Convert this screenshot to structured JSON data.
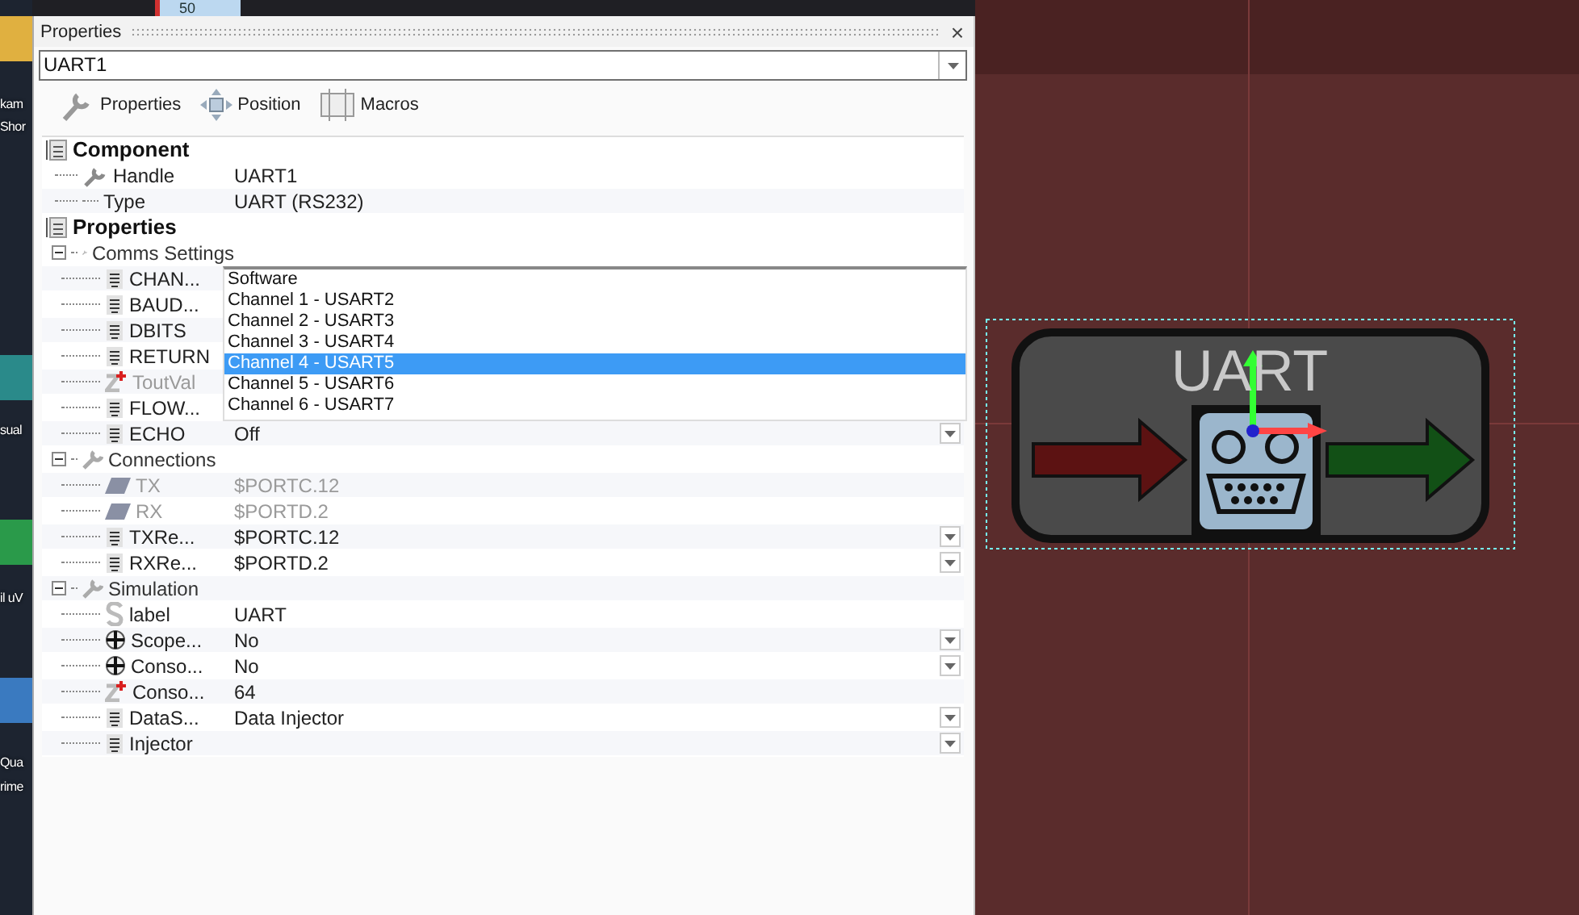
{
  "desktop_icons": [
    {
      "label": "kam",
      "top": "Shor"
    },
    {
      "label": "sual"
    },
    {
      "label": "il uV"
    },
    {
      "label": "Qua",
      "top": "rime"
    }
  ],
  "top_strip": {
    "text": "50"
  },
  "panel": {
    "title": "Properties",
    "close": "×",
    "selector": {
      "value": "UART1"
    },
    "tabs": [
      {
        "label": "Properties"
      },
      {
        "label": "Position"
      },
      {
        "label": "Macros"
      }
    ]
  },
  "grid": [
    {
      "title": "Component",
      "children": [
        {
          "kind": "wrench",
          "name": "Handle",
          "value": "UART1",
          "disabled": false,
          "dropdown": false
        },
        {
          "kind": "plain",
          "name": "Type",
          "value": "UART (RS232)",
          "disabled": false,
          "dropdown": false
        }
      ]
    },
    {
      "title": "Properties",
      "children": [
        {
          "kind": "group",
          "title": "Comms Settings",
          "expanded": true,
          "children": [
            {
              "kind": "list",
              "name": "CHAN...",
              "disabled": false,
              "dropdown": false
            },
            {
              "kind": "list",
              "name": "BAUD...",
              "disabled": false,
              "dropdown": false
            },
            {
              "kind": "list",
              "name": "DBITS",
              "disabled": false,
              "dropdown": false
            },
            {
              "kind": "list",
              "name": "RETURN",
              "disabled": false,
              "dropdown": false
            },
            {
              "kind": "number",
              "name": "ToutVal",
              "disabled": true,
              "dropdown": false
            },
            {
              "kind": "list",
              "name": "FLOW...",
              "disabled": false,
              "dropdown": false
            },
            {
              "kind": "list",
              "name": "ECHO",
              "value": "Off",
              "disabled": false,
              "dropdown": true
            }
          ]
        },
        {
          "kind": "group",
          "title": "Connections",
          "expanded": true,
          "children": [
            {
              "kind": "port",
              "name": "TX",
              "value": "$PORTC.12",
              "disabled": true,
              "dropdown": false
            },
            {
              "kind": "port",
              "name": "RX",
              "value": "$PORTD.2",
              "disabled": true,
              "dropdown": false
            },
            {
              "kind": "list",
              "name": "TXRe...",
              "value": "$PORTC.12",
              "disabled": false,
              "dropdown": true
            },
            {
              "kind": "list",
              "name": "RXRe...",
              "value": "$PORTD.2",
              "disabled": false,
              "dropdown": true
            }
          ]
        },
        {
          "kind": "group",
          "title": "Simulation",
          "expanded": true,
          "children": [
            {
              "kind": "string",
              "name": "label",
              "value": "UART",
              "disabled": false,
              "dropdown": false
            },
            {
              "kind": "plus",
              "name": "Scope...",
              "value": "No",
              "disabled": false,
              "dropdown": true
            },
            {
              "kind": "plus",
              "name": "Conso...",
              "value": "No",
              "disabled": false,
              "dropdown": true
            },
            {
              "kind": "number",
              "name": "Conso...",
              "value": "64",
              "disabled": false,
              "dropdown": false
            },
            {
              "kind": "list",
              "name": "DataS...",
              "value": "Data Injector",
              "disabled": false,
              "dropdown": true
            },
            {
              "kind": "list",
              "name": "Injector",
              "disabled": false,
              "dropdown": true
            }
          ]
        }
      ]
    }
  ],
  "dropdown_list": {
    "items": [
      {
        "label": "Software",
        "selected": false
      },
      {
        "label": "Channel 1 - USART2",
        "selected": false
      },
      {
        "label": "Channel 2 - USART3",
        "selected": false
      },
      {
        "label": "Channel 3 - USART4",
        "selected": false
      },
      {
        "label": "Channel 4 - USART5",
        "selected": true
      },
      {
        "label": "Channel 5 - USART6",
        "selected": false
      },
      {
        "label": "Channel 6 - USART7",
        "selected": false
      }
    ]
  },
  "canvas": {
    "component": {
      "label": "UART",
      "selected": true
    }
  }
}
